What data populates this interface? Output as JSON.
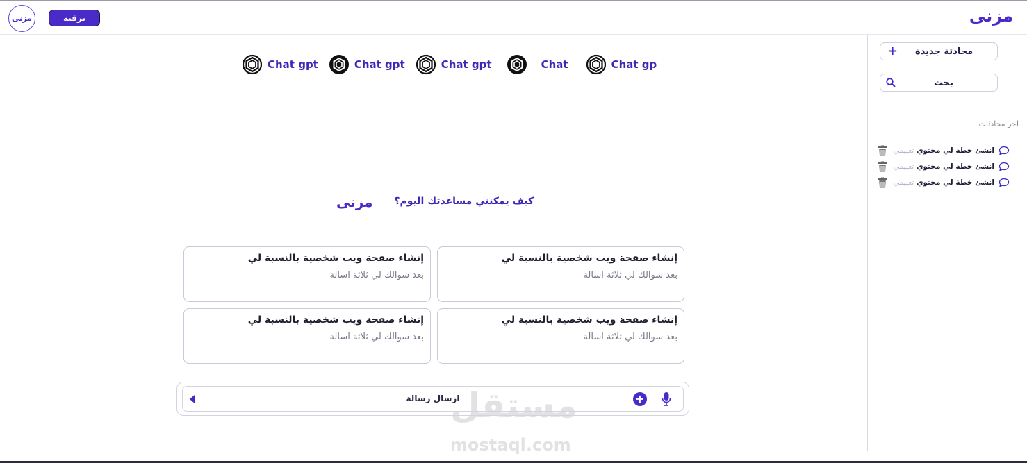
{
  "header": {
    "avatar_text": "مزنى",
    "upgrade_label": "ترقية",
    "brand_text": "مزنى"
  },
  "sidebar": {
    "new_chat_label": "محادثة جديدة",
    "search_label": "بحث",
    "recent_title": "اخر محادثات",
    "conversations": [
      {
        "bold": "انشئ خطة لي محتوي ",
        "faded": "تعليمي"
      },
      {
        "bold": "انشئ خطة لي محتوي ",
        "faded": "تعليمي"
      },
      {
        "bold": "انشئ خطة لي محتوي ",
        "faded": "تعليمي"
      }
    ]
  },
  "models": [
    "Chat gpt",
    "Chat gpt",
    "Chat gpt",
    "Chat",
    "Chat gp"
  ],
  "greeting": {
    "text": "كيف يمكنني مساعدتك اليوم؟",
    "logo_text": "مزنى"
  },
  "cards": [
    {
      "title": "إنشاء صفحة ويب شخصية بالنسبة لي",
      "subtitle": "بعد سوالك لي ثلاثة اسالة"
    },
    {
      "title": "إنشاء صفحة ويب شخصية بالنسبة لي",
      "subtitle": "بعد سوالك لي ثلاثة اسالة"
    },
    {
      "title": "إنشاء صفحة ويب شخصية بالنسبة لي",
      "subtitle": "بعد سوالك لي ثلاثة اسالة"
    },
    {
      "title": "إنشاء صفحة ويب شخصية بالنسبة لي",
      "subtitle": "بعد سوالك لي ثلاثة اسالة"
    }
  ],
  "composer": {
    "placeholder": "ارسال رسالة"
  },
  "watermark": {
    "arabic": "مستقل",
    "latin": "mostaql.com"
  },
  "colors": {
    "accent": "#4b2bc7",
    "accent_text": "#3d28b5"
  },
  "icons": [
    "openai-icon",
    "search-icon",
    "trash-icon",
    "chat-bubble-icon",
    "mic-icon",
    "plus-icon",
    "send-arrow-icon"
  ]
}
